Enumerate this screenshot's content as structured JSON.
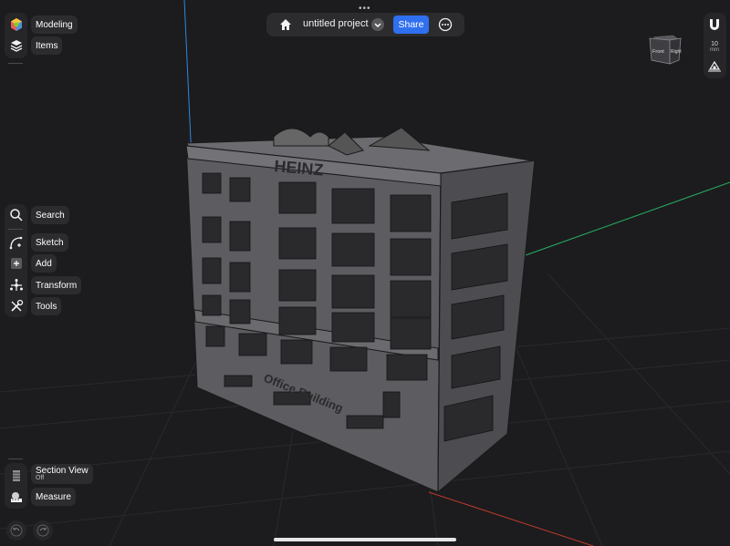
{
  "header": {
    "project_title": "untitled project",
    "share_label": "Share"
  },
  "left_top": {
    "modeling_label": "Modeling",
    "items_label": "Items"
  },
  "tools": {
    "search_label": "Search",
    "sketch_label": "Sketch",
    "add_label": "Add",
    "transform_label": "Transform",
    "tools_label": "Tools"
  },
  "bottom": {
    "section_view_label": "Section View",
    "section_view_status": "Off",
    "measure_label": "Measure"
  },
  "right_rail": {
    "scale_value": "10",
    "scale_unit": "mm"
  },
  "viewcube": {
    "front_label": "Front",
    "right_label": "Right"
  },
  "model": {
    "sign_top": "HEINZ",
    "sign_front": "Office Building"
  },
  "colors": {
    "background": "#1c1c1e",
    "accent": "#2f6ff0",
    "axis_x": "#c0392b",
    "axis_y": "#27ae60",
    "axis_z": "#2e86de"
  }
}
